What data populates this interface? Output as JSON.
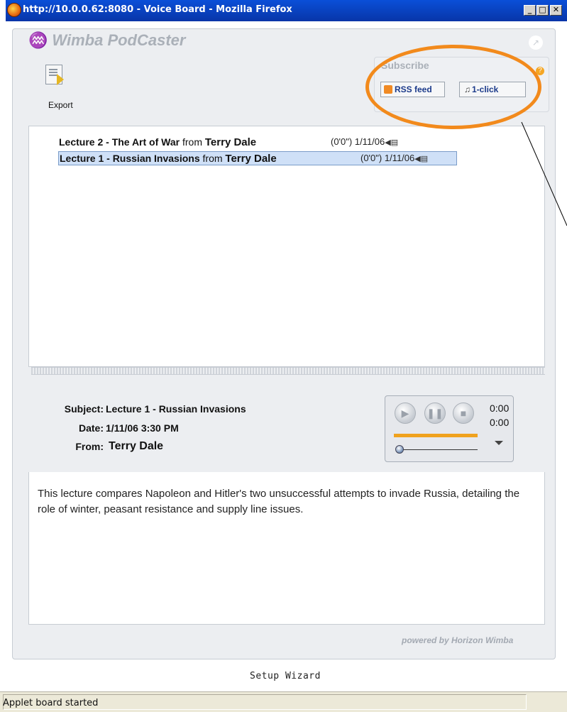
{
  "window": {
    "title": "http://10.0.0.62:8080 - Voice Board - Mozilla Firefox",
    "min_label": "_",
    "max_label": "□",
    "close_label": "✕"
  },
  "app": {
    "logo_text": "Wimba PodCaster",
    "export_label": "Export",
    "powered_by": "powered by Horizon Wimba",
    "setup_wizard": "Setup Wizard"
  },
  "subscribe": {
    "title": "Subscribe",
    "rss_label": "RSS feed",
    "oneclick_label": "1-click",
    "help_glyph": "?"
  },
  "lectures": [
    {
      "title": "Lecture 2 - The Art of War",
      "from_word": "from",
      "author": "Terry Dale",
      "length": "(0'0\")",
      "date": "1/11/06",
      "selected": false
    },
    {
      "title": "Lecture 1 - Russian Invasions",
      "from_word": "from",
      "author": "Terry Dale",
      "length": "(0'0\")",
      "date": "1/11/06",
      "selected": true
    }
  ],
  "detail": {
    "subject_label": "Subject:",
    "subject": "Lecture 1 - Russian Invasions",
    "date_label": "Date:",
    "date": "1/11/06 3:30 PM",
    "from_label": "From:",
    "from": "Terry Dale",
    "description": "This lecture compares Napoleon and Hitler's two unsuccessful attempts to invade Russia, detailing the role of winter, peasant resistance and supply line issues."
  },
  "player": {
    "elapsed": "0:00",
    "total": "0:00",
    "progress": 1.0,
    "position": 0.0
  },
  "status": {
    "text": "Applet board started"
  },
  "colors": {
    "titlebar": "#0a4fd8",
    "highlight_ellipse": "#f28a1c",
    "selection": "#cfe0f7",
    "progress": "#f0a21e"
  }
}
